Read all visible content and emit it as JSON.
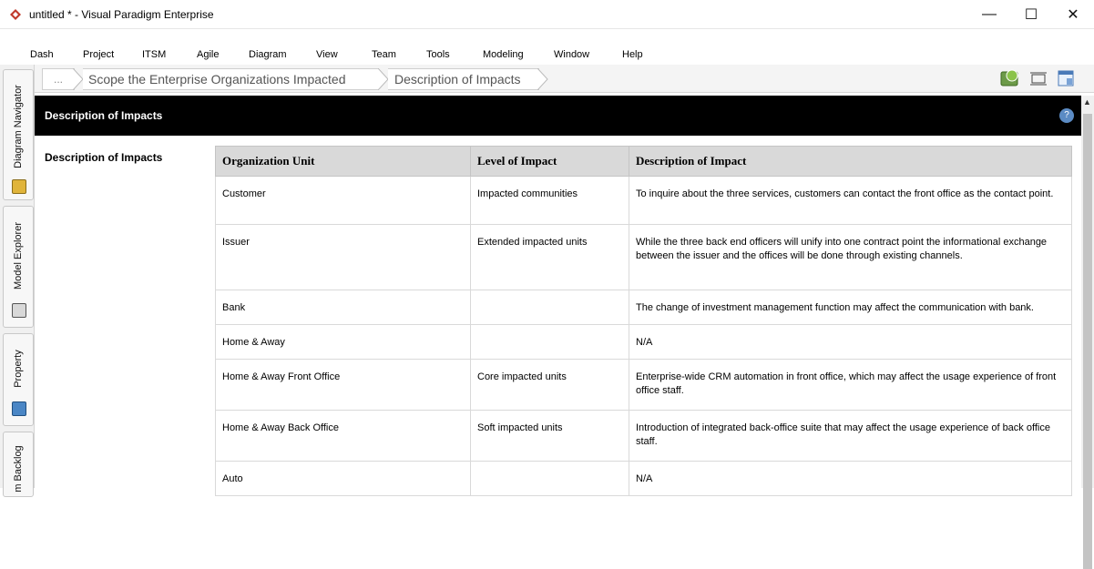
{
  "window": {
    "title": "untitled * - Visual Paradigm Enterprise",
    "minimize_glyph": "—",
    "maximize_glyph": "☐",
    "close_glyph": "✕"
  },
  "menu": [
    "Dash",
    "Project",
    "ITSM",
    "Agile",
    "Diagram",
    "View",
    "Team",
    "Tools",
    "Modeling",
    "Window",
    "Help"
  ],
  "dock": {
    "tabs": [
      "Diagram Navigator",
      "Model Explorer",
      "Property",
      "m Backlog"
    ]
  },
  "breadcrumb": {
    "ellipsis": "...",
    "items": [
      "Scope the Enterprise Organizations Impacted",
      "Description of Impacts"
    ]
  },
  "header": {
    "title": "Description of Impacts"
  },
  "section": {
    "label": "Description of Impacts"
  },
  "table": {
    "columns": [
      "Organization Unit",
      "Level of Impact",
      "Description of Impact"
    ],
    "rows": [
      {
        "unit": "Customer",
        "level": "Impacted communities",
        "desc": "To inquire about the three services, customers can contact the front office as the contact point."
      },
      {
        "unit": "Issuer",
        "level": "Extended impacted units",
        "desc": "While the three back end officers will unify into one contract point the informational exchange between the issuer and the offices will be done through existing channels."
      },
      {
        "unit": "Bank",
        "level": "",
        "desc": "The change of investment management function may affect the communication with bank."
      },
      {
        "unit": "Home & Away",
        "level": "",
        "desc": "N/A"
      },
      {
        "unit": "Home & Away Front Office",
        "level": "Core impacted units",
        "desc": "Enterprise-wide CRM automation in front office, which may affect the usage experience of front office staff."
      },
      {
        "unit": "Home & Away Back Office",
        "level": "Soft impacted units",
        "desc": "Introduction of integrated back-office suite that may affect the usage experience of back office staff."
      },
      {
        "unit": "Auto",
        "level": "",
        "desc": "N/A"
      }
    ]
  },
  "colors": {
    "header_bg": "#000000",
    "table_header_bg": "#d9d9d9",
    "app_logo": "#c0392b"
  },
  "icons": [
    "app-logo-icon",
    "notification-icon",
    "fit-width-icon",
    "panel-icon",
    "help-icon"
  ]
}
